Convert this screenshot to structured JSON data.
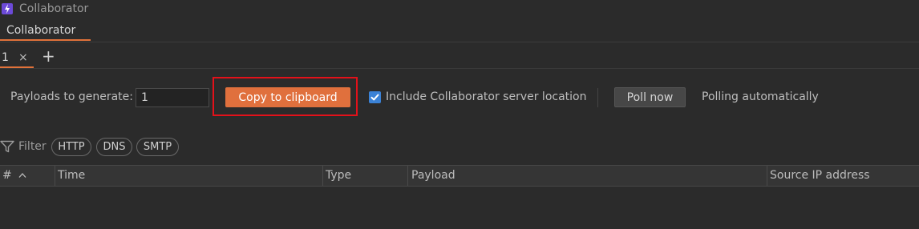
{
  "window": {
    "title": "Collaborator"
  },
  "main_tabs": [
    {
      "label": "Collaborator",
      "active": true
    }
  ],
  "sub_tabs": [
    {
      "label": "1",
      "close": "×",
      "active": true
    }
  ],
  "add_tab": "+",
  "toolbar": {
    "payloads_label": "Payloads to generate:",
    "payloads_value": "1",
    "copy_button": "Copy to clipboard",
    "include_label": "Include Collaborator server location",
    "include_checked": true,
    "poll_button": "Poll now",
    "polling_status": "Polling automatically"
  },
  "filter": {
    "label": "Filter",
    "chips": [
      "HTTP",
      "DNS",
      "SMTP"
    ]
  },
  "table": {
    "columns": [
      "#",
      "Time",
      "Type",
      "Payload",
      "Source IP address"
    ],
    "sort_indicator": "^",
    "rows": []
  },
  "colors": {
    "accent": "#e0703d",
    "highlight": "#e3111a",
    "checkbox": "#3b82d6",
    "background": "#2b2b2b"
  }
}
